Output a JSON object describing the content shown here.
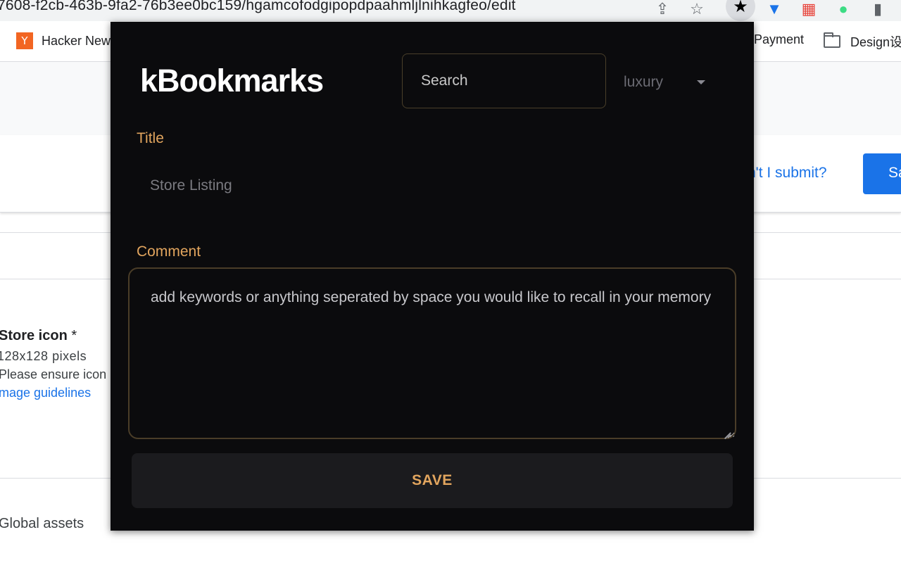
{
  "browser": {
    "address_text": "7608-f2cb-463b-9fa2-76b3ee0bc159/hgamcofodgipopdpaahmljlnihkagfeo/edit",
    "bookmarks": [
      {
        "label": "Hacker New",
        "icon": "ycombinator-icon"
      },
      {
        "label": "Payment",
        "icon": ""
      },
      {
        "label": "Design设",
        "icon": "folder-icon"
      }
    ]
  },
  "background_page": {
    "cant_submit_link": "n't I submit?",
    "save_button": "Sa",
    "store_icon": {
      "title": "Store icon",
      "required_mark": "*",
      "size": "128x128 pixels",
      "ensure_text": "Please ensure icon",
      "guidelines_link": "mage guidelines"
    },
    "global_assets": "Global assets"
  },
  "popup": {
    "logo": "kBookmarks",
    "search_placeholder": "Search",
    "category_selected": "luxury",
    "title_label": "Title",
    "title_placeholder": "Store Listing",
    "comment_label": "Comment",
    "comment_text": "add keywords or anything seperated by space you would like to recall in your memory",
    "save_label": "SAVE",
    "colors": {
      "accent": "#e2a55e",
      "background": "#0b0b0d",
      "button_bg": "#1b1b1e",
      "border": "#4a3d28"
    }
  }
}
